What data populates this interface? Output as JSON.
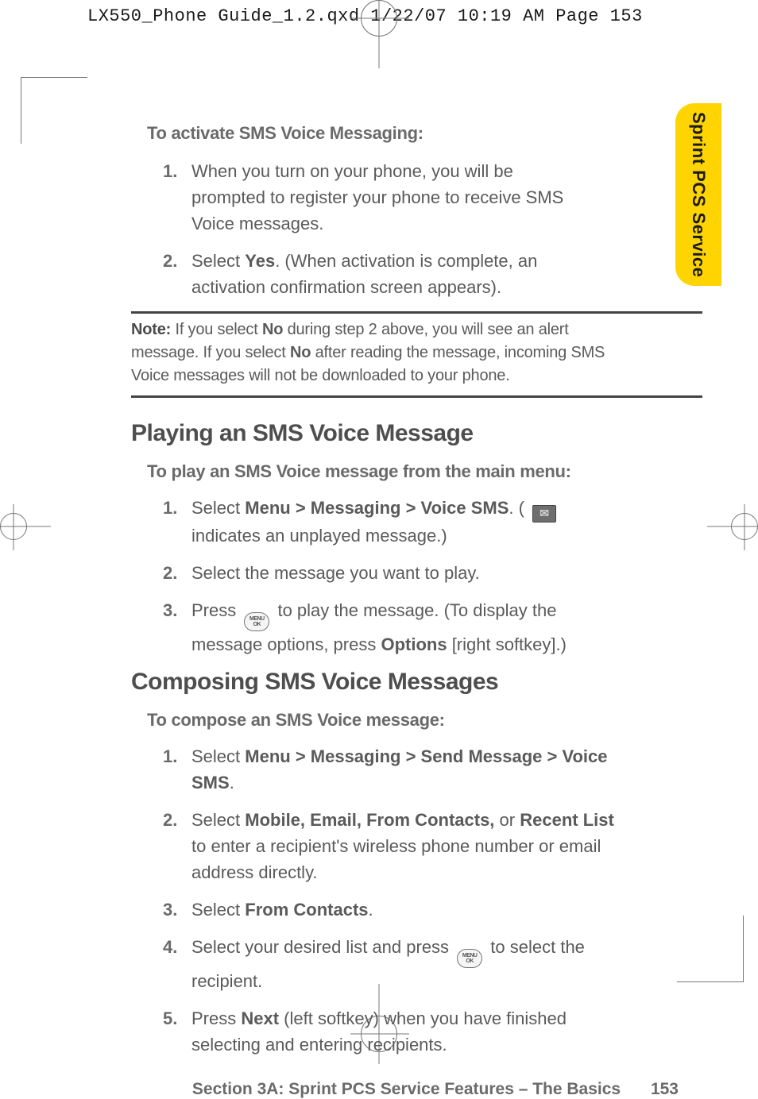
{
  "print_header": "LX550_Phone Guide_1.2.qxd  1/22/07  10:19 AM  Page 153",
  "side_tab": "Sprint PCS Service",
  "activate": {
    "lead": "To activate SMS Voice Messaging:",
    "step1": "When you turn on your phone, you will be prompted to register your phone to receive SMS Voice messages.",
    "step2_a": "Select ",
    "step2_yes": "Yes",
    "step2_b": ". (When activation is complete, an activation confirmation screen appears)."
  },
  "note": {
    "label": "Note:",
    "a": " If you select ",
    "no1": "No",
    "b": " during step 2 above, you will see an alert message. If you select ",
    "no2": "No",
    "c": " after reading the message, incoming SMS Voice messages will not be downloaded to your phone."
  },
  "playing": {
    "heading": "Playing an SMS Voice Message",
    "lead": "To play an SMS Voice message from the main menu:",
    "step1_a": "Select ",
    "step1_path": "Menu > Messaging > Voice SMS",
    "step1_b": ". ( ",
    "step1_c": " indicates an unplayed message.)",
    "step2": "Select the message you want to play.",
    "step3_a": "Press ",
    "step3_b": " to play the message. (To display the message options, press ",
    "step3_opt": "Options",
    "step3_c": " [right softkey].)"
  },
  "composing": {
    "heading": "Composing SMS Voice Messages",
    "lead": "To compose an SMS Voice message:",
    "step1_a": "Select ",
    "step1_path": "Menu > Messaging > Send Message > Voice SMS",
    "step1_b": ".",
    "step2_a": "Select ",
    "step2_bold": "Mobile, Email, From Contacts,",
    "step2_or": " or ",
    "step2_bold2": "Recent List",
    "step2_b": " to enter a recipient's wireless phone number or email address directly.",
    "step3_a": "Select ",
    "step3_bold": "From Contacts",
    "step3_b": ".",
    "step4_a": "Select your desired list and press ",
    "step4_b": " to select the recipient.",
    "step5_a": "Press ",
    "step5_bold": "Next",
    "step5_b": " (left softkey) when you have finished selecting and entering recipients."
  },
  "footer": {
    "section": "Section 3A: Sprint PCS Service Features – The Basics",
    "page": "153"
  }
}
